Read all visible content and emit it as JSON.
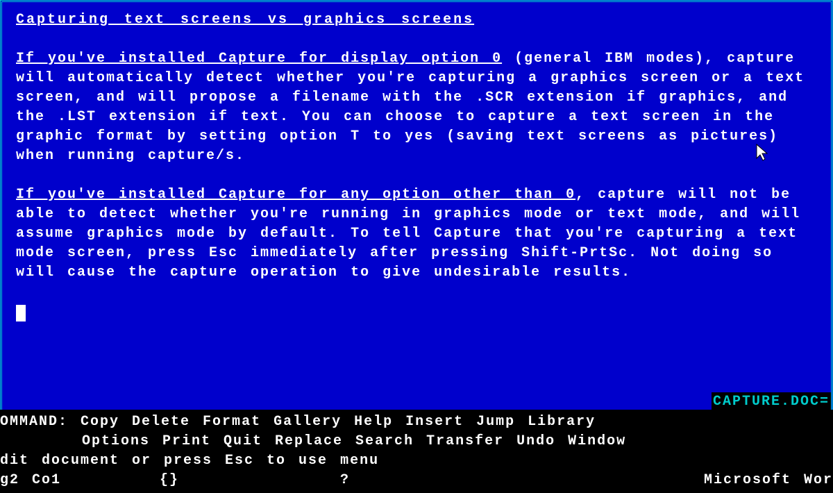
{
  "document": {
    "heading": "Capturing text screens vs graphics screens",
    "para1_lead": "If you've installed Capture for display option 0",
    "para1_body": " (general IBM modes), capture will automatically detect whether you're capturing a graphics screen or a text screen, and will propose a filename with the .SCR extension if graphics, and the .LST extension if text. You can choose to capture a text screen in the graphic format by setting option T to yes (saving text screens as pictures) when running capture/s.",
    "para2_lead": "If you've installed Capture for any option other than 0",
    "para2_body": ", capture will not be able to detect whether you're running in graphics mode or text mode, and will assume graphics mode by default. To tell Capture that you're capturing a text mode screen, press Esc immediately after pressing Shift-PrtSc. Not doing so will cause the capture operation to give undesirable results.",
    "filename": "CAPTURE.DOC="
  },
  "command": {
    "label": "OMMAND:",
    "row1": "Copy Delete Format Gallery Help Insert Jump Library",
    "row2": "Options Print Quit Replace Search Transfer Undo Window",
    "hint": "dit document or press Esc to use menu"
  },
  "status": {
    "position": "g2 Co1",
    "braces": "{}",
    "indicator": "?",
    "app": "Microsoft Wor"
  }
}
